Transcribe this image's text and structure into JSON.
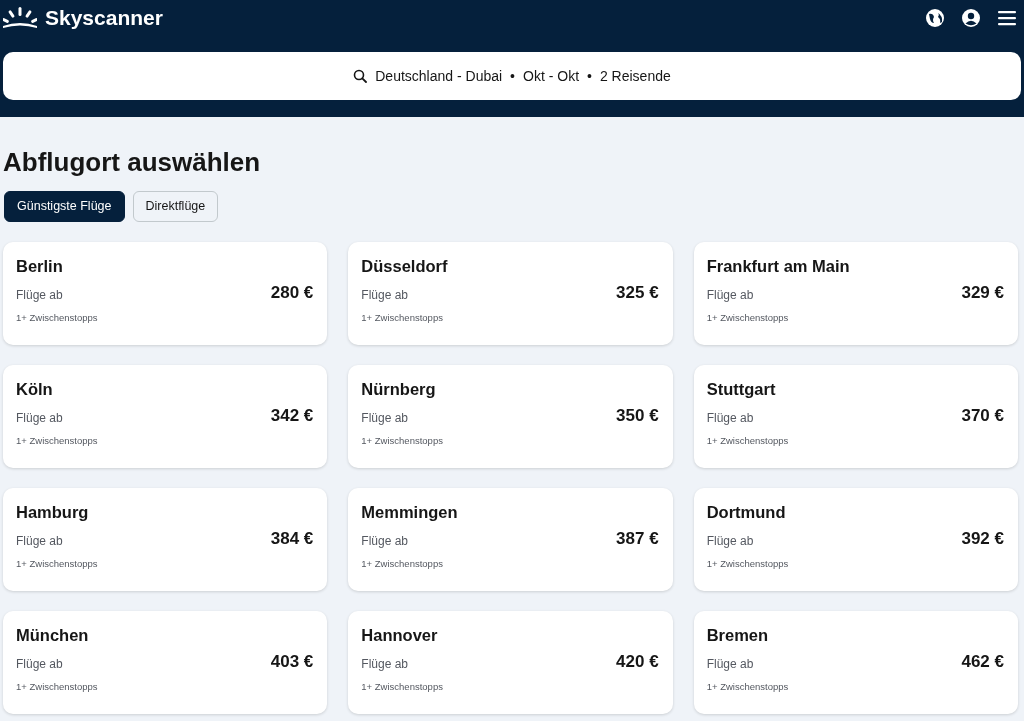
{
  "header": {
    "logo": "Skyscanner"
  },
  "search": {
    "parts": [
      "Deutschland - Dubai",
      "•",
      "Okt - Okt",
      "•",
      "2 Reisende"
    ]
  },
  "title": "Abflugort auswählen",
  "filters": [
    {
      "label": "Günstigste Flüge",
      "selected": true
    },
    {
      "label": "Direktflüge",
      "selected": false
    }
  ],
  "destinations": [
    {
      "city": "Berlin",
      "label": "Flüge ab",
      "price": "280 €",
      "stops": "1+ Zwischenstopps"
    },
    {
      "city": "Düsseldorf",
      "label": "Flüge ab",
      "price": "325 €",
      "stops": "1+ Zwischenstopps"
    },
    {
      "city": "Frankfurt am Main",
      "label": "Flüge ab",
      "price": "329 €",
      "stops": "1+ Zwischenstopps"
    },
    {
      "city": "Köln",
      "label": "Flüge ab",
      "price": "342 €",
      "stops": "1+ Zwischenstopps"
    },
    {
      "city": "Nürnberg",
      "label": "Flüge ab",
      "price": "350 €",
      "stops": "1+ Zwischenstopps"
    },
    {
      "city": "Stuttgart",
      "label": "Flüge ab",
      "price": "370 €",
      "stops": "1+ Zwischenstopps"
    },
    {
      "city": "Hamburg",
      "label": "Flüge ab",
      "price": "384 €",
      "stops": "1+ Zwischenstopps"
    },
    {
      "city": "Memmingen",
      "label": "Flüge ab",
      "price": "387 €",
      "stops": "1+ Zwischenstopps"
    },
    {
      "city": "Dortmund",
      "label": "Flüge ab",
      "price": "392 €",
      "stops": "1+ Zwischenstopps"
    },
    {
      "city": "München",
      "label": "Flüge ab",
      "price": "403 €",
      "stops": "1+ Zwischenstopps"
    },
    {
      "city": "Hannover",
      "label": "Flüge ab",
      "price": "420 €",
      "stops": "1+ Zwischenstopps"
    },
    {
      "city": "Bremen",
      "label": "Flüge ab",
      "price": "462 €",
      "stops": "1+ Zwischenstopps"
    }
  ]
}
